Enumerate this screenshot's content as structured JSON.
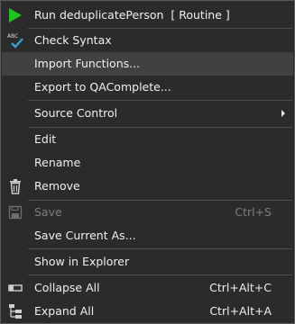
{
  "menu": {
    "items": [
      {
        "label": "Run deduplicatePerson  [ Routine ]",
        "icon": "run-icon"
      },
      {
        "label": "Check Syntax",
        "icon": "check-syntax-icon"
      },
      {
        "label": "Import Functions...",
        "highlighted": true
      },
      {
        "label": "Export to QAComplete..."
      },
      {
        "label": "Source Control",
        "has_submenu": true
      },
      {
        "label": "Edit"
      },
      {
        "label": "Rename"
      },
      {
        "label": "Remove",
        "icon": "trash-icon"
      },
      {
        "label": "Save",
        "shortcut": "Ctrl+S",
        "disabled": true,
        "icon": "save-icon"
      },
      {
        "label": "Save Current As..."
      },
      {
        "label": "Show in Explorer"
      },
      {
        "label": "Collapse All",
        "shortcut": "Ctrl+Alt+C",
        "icon": "collapse-all-icon"
      },
      {
        "label": "Expand All",
        "shortcut": "Ctrl+Alt+A",
        "icon": "expand-all-icon"
      }
    ]
  },
  "colors": {
    "background": "#2b2b2b",
    "highlight": "#414141",
    "text": "#f0f0f0",
    "disabled_text": "#7e7e7e",
    "run_icon": "#1ec31e",
    "check_icon": "#3b9ad9"
  }
}
